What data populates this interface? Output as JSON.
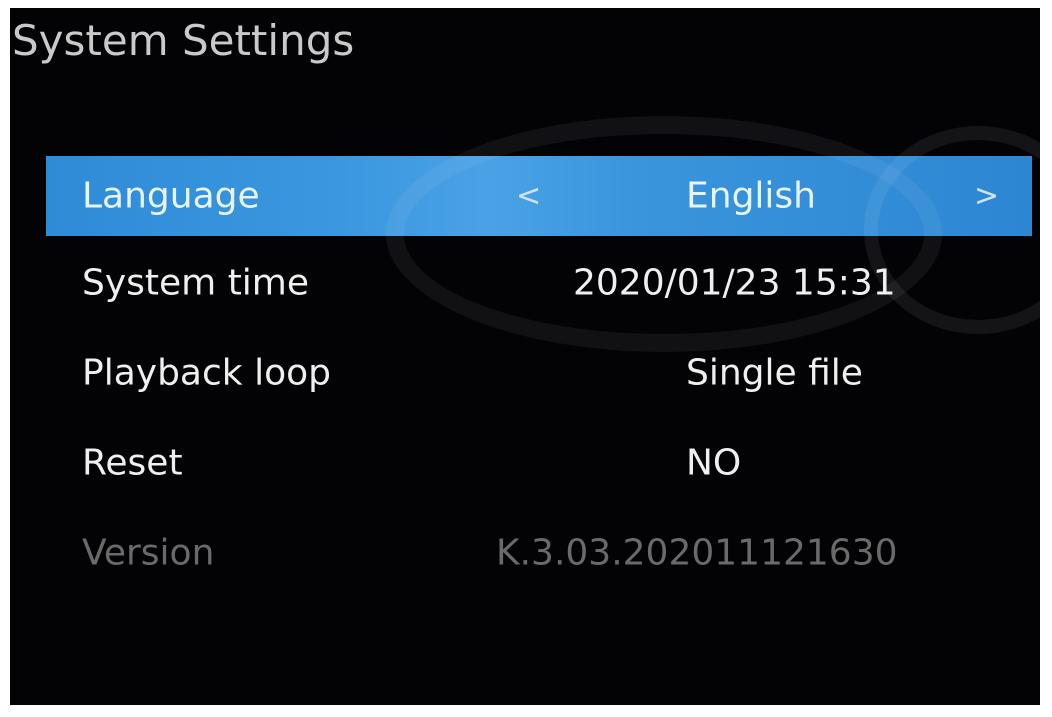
{
  "title": "System Settings",
  "menu": {
    "items": [
      {
        "label": "Language",
        "value": "English",
        "arrow_left": "<",
        "arrow_right": ">",
        "selected": true
      },
      {
        "label": "System time",
        "value": "2020/01/23 15:31"
      },
      {
        "label": "Playback loop",
        "value": "Single file"
      },
      {
        "label": "Reset",
        "value": "NO"
      },
      {
        "label": "Version",
        "value": "K.3.03.202011121630",
        "disabled": true
      }
    ]
  },
  "colors": {
    "background": "#030305",
    "highlight": "#3a95dc",
    "text": "#efefef",
    "disabled_text": "#6a6a6a"
  }
}
